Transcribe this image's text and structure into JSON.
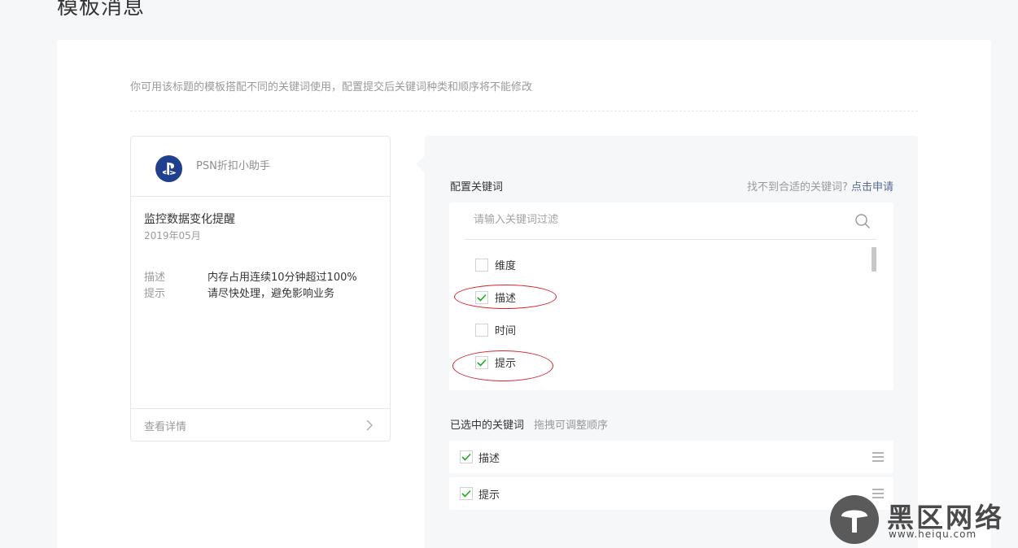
{
  "page": {
    "title": "模板消息"
  },
  "tip": "你可用该标题的模板搭配不同的关键词使用，配置提交后关键词种类和顺序将不能修改",
  "preview": {
    "account_name": "PSN折扣小助手",
    "message_title": "监控数据变化提醒",
    "date": "2019年05月",
    "fields": [
      {
        "key": "描述",
        "value": "内存占用连续10分钟超过100%"
      },
      {
        "key": "提示",
        "value": "请尽快处理，避免影响业务"
      }
    ],
    "view_detail": "查看详情"
  },
  "config": {
    "label": "配置关键词",
    "help_text": "找不到合适的关键词?",
    "apply_link": "点击申请",
    "search_placeholder": "请输入关键词过滤",
    "keywords": [
      {
        "label": "维度",
        "checked": false
      },
      {
        "label": "描述",
        "checked": true
      },
      {
        "label": "时间",
        "checked": false
      },
      {
        "label": "提示",
        "checked": true
      }
    ],
    "selected_label": "已选中的关键词",
    "selected_hint": "拖拽可调整顺序",
    "selected": [
      {
        "label": "描述"
      },
      {
        "label": "提示"
      }
    ]
  },
  "watermark": {
    "text": "黑区网络",
    "url": "www.heiqu.com"
  },
  "colors": {
    "check": "#1aad19",
    "link": "#576b95",
    "annotation": "#d9232d"
  }
}
